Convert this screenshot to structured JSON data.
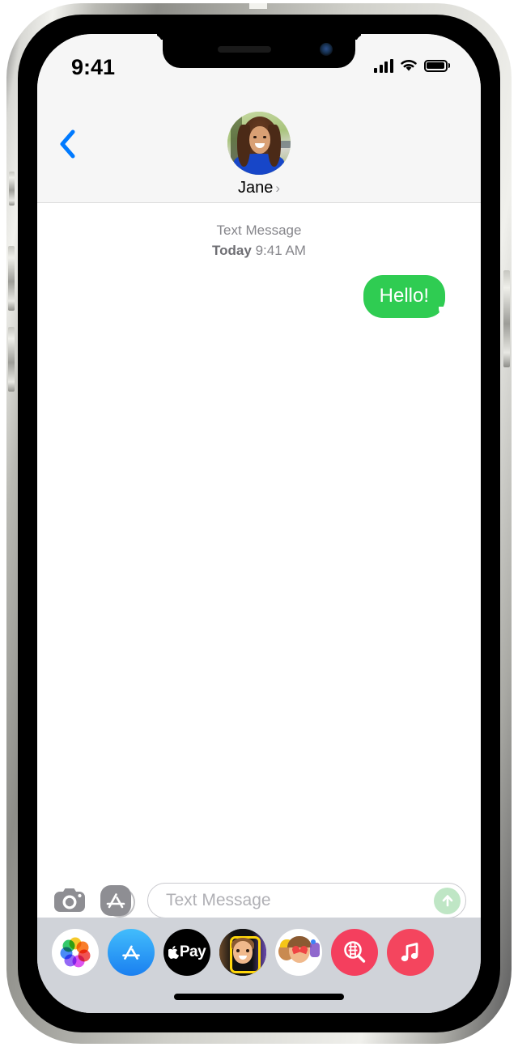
{
  "device": {
    "name": "iPhone",
    "frame_color": "#cfcfc9",
    "screen_bg": "#ffffff"
  },
  "status_bar": {
    "time": "9:41",
    "cellular_icon": "cellular-bars-icon",
    "cellular_bars": 4,
    "wifi_icon": "wifi-icon",
    "battery_icon": "battery-full-icon",
    "battery_level": 100
  },
  "notch": {
    "speaker_icon": "speaker-grille-icon",
    "camera_icon": "front-camera-icon"
  },
  "header": {
    "back_icon": "chevron-left-icon",
    "back_color": "#007aff",
    "avatar_name": "avatar",
    "contact_name": "Jane",
    "name_chevron": "›",
    "background": "#f6f6f6"
  },
  "thread": {
    "meta_kind": "Text Message",
    "meta_when_bold": "Today",
    "meta_when_rest": " 9:41 AM",
    "messages": [
      {
        "text": "Hello!",
        "direction": "sent",
        "service": "sms",
        "bubble_color": "#2fcc52",
        "text_color": "#ffffff"
      }
    ]
  },
  "input_bar": {
    "camera_icon": "camera-icon",
    "appstore_icon": "app-store-icon",
    "placeholder": "Text Message",
    "value": "",
    "send_icon": "send-arrow-up-icon",
    "send_color": "#bfe6c5"
  },
  "app_drawer": {
    "background": "#d0d3d9",
    "apps": [
      {
        "name": "photos",
        "label": "Photos",
        "icon": "photos-icon",
        "color": "#ffffff"
      },
      {
        "name": "appstore",
        "label": "App Store",
        "icon": "app-store-icon",
        "color": "#1a7ff0"
      },
      {
        "name": "applepay",
        "label": "Apple Pay",
        "icon": "apple-pay-icon",
        "color": "#000000",
        "text": "Pay"
      },
      {
        "name": "memoji",
        "label": "Memoji",
        "icon": "memoji-icon",
        "color": "#000000"
      },
      {
        "name": "stickers",
        "label": "Stickers",
        "icon": "stickers-icon",
        "color": "#ffffff"
      },
      {
        "name": "images",
        "label": "#images",
        "icon": "images-search-icon",
        "color": "#f43f5e"
      },
      {
        "name": "music",
        "label": "Music",
        "icon": "music-note-icon",
        "color": "#f4455e"
      }
    ]
  },
  "home_indicator": {
    "icon": "home-indicator"
  }
}
